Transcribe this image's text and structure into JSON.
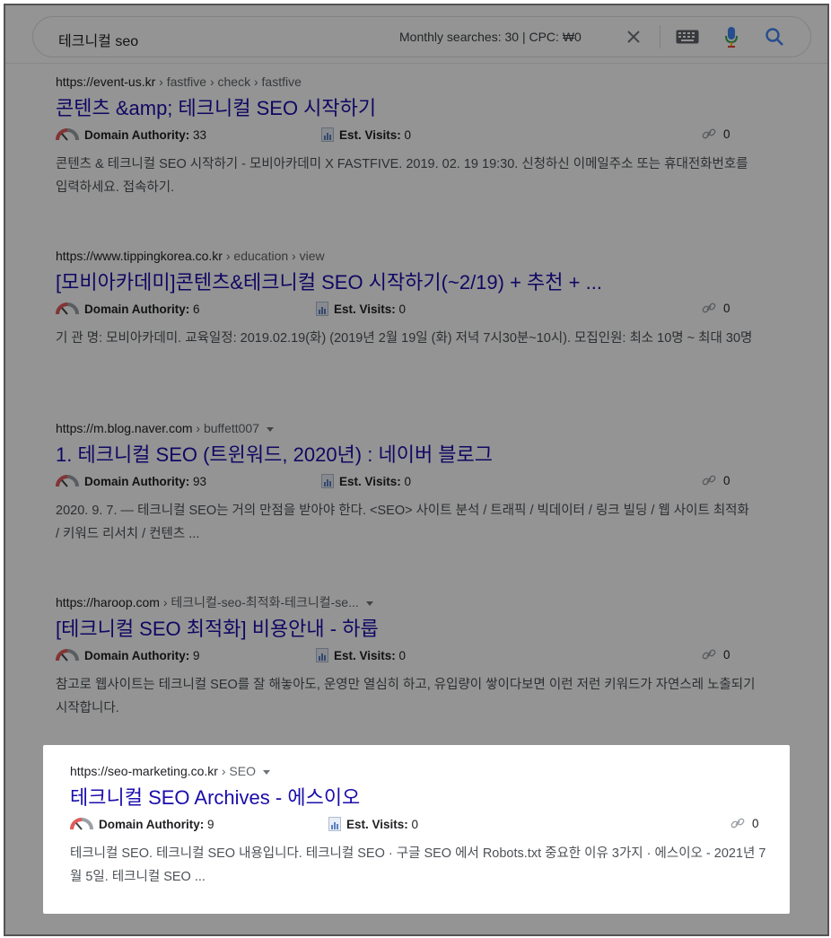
{
  "search": {
    "query": "테크니컬 seo",
    "metrics_text": "Monthly searches: 30 | CPC: ₩0"
  },
  "labels": {
    "domain_authority": "Domain Authority:",
    "est_visits": "Est. Visits:"
  },
  "results": [
    {
      "site": "https://event-us.kr",
      "path": " › fastfive › check › fastfive",
      "title": "콘텐츠 &amp; 테크니컬 SEO 시작하기",
      "domain_authority": "33",
      "est_visits": "0",
      "links": "0",
      "snippet": "콘텐츠 & 테크니컬 SEO 시작하기 - 모비아카데미 X FASTFIVE. 2019. 02. 19 19:30. 신청하신 이메일주소 또는 휴대전화번호를 입력하세요. 접속하기."
    },
    {
      "site": "https://www.tippingkorea.co.kr",
      "path": " › education › view",
      "title": "[모비아카데미]콘텐츠&테크니컬 SEO 시작하기(~2/19) + 추천 + ...",
      "domain_authority": "6",
      "est_visits": "0",
      "links": "0",
      "snippet": "기 관 명: 모비아카데미. 교육일정: 2019.02.19(화) (2019년 2월 19일 (화) 저녁 7시30분~10시). 모집인원: 최소 10명 ~ 최대 30명"
    },
    {
      "site": "https://m.blog.naver.com",
      "path": " › buffett007",
      "title": "1. 테크니컬 SEO (트윈워드, 2020년) : 네이버 블로그",
      "domain_authority": "93",
      "est_visits": "0",
      "links": "0",
      "snippet": "2020. 9. 7. — 테크니컬 SEO는 거의 만점을 받아야 한다. <SEO> 사이트 분석 / 트래픽 / 빅데이터 / 링크 빌딩 / 웹 사이트 최적화 / 키워드 리서치 / 컨텐츠 ..."
    },
    {
      "site": "https://haroop.com",
      "path": " › 테크니컬-seo-최적화-테크니컬-se...",
      "title": "[테크니컬 SEO 최적화] 비용안내 - 하룹",
      "domain_authority": "9",
      "est_visits": "0",
      "links": "0",
      "snippet": "참고로 웹사이트는 테크니컬 SEO를 잘 해놓아도, 운영만 열심히 하고, 유입량이 쌓이다보면 이런 저런 키워드가 자연스레 노출되기 시작합니다."
    },
    {
      "site": "https://seo-marketing.co.kr",
      "path": " › SEO",
      "title": "테크니컬 SEO Archives - 에스이오",
      "domain_authority": "9",
      "est_visits": "0",
      "links": "0",
      "snippet": "테크니컬 SEO. 테크니컬 SEO 내용입니다. 테크니컬 SEO · 구글 SEO 에서 Robots.txt 중요한 이유 3가지 · 에스이오 - 2021년 7월 5일. 테크니컬 SEO ..."
    }
  ],
  "colors": {
    "link": "#1a0dab",
    "text": "#202124",
    "snippet": "#4d5156",
    "dim_overlay": "rgba(0,0,0,0.42)"
  }
}
